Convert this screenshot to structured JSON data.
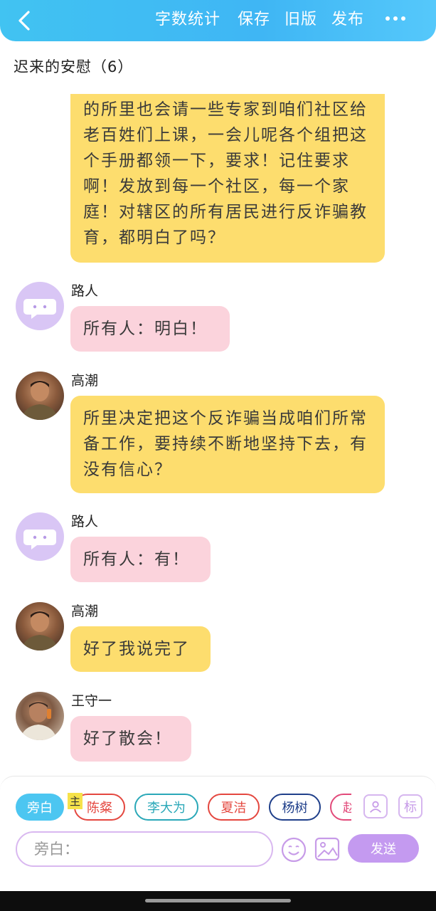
{
  "header": {
    "menu": [
      "字数统计",
      "保存",
      "旧版",
      "发布"
    ]
  },
  "title": "迟来的安慰（6）",
  "messages": [
    {
      "speaker": "",
      "text": "的所里也会请一些专家到咱们社区给老百姓们上课，一会儿呢各个组把这个手册都领一下，要求！记住要求啊！发放到每一个社区，每一个家庭！对辖区的所有居民进行反诈骗教育，都明白了吗？",
      "color": "yellow"
    },
    {
      "speaker": "路人",
      "text": "所有人：明白！",
      "color": "pink"
    },
    {
      "speaker": "高潮",
      "text": "所里决定把这个反诈骗当成咱们所常备工作，要持续不断地坚持下去，有没有信心？",
      "color": "yellow"
    },
    {
      "speaker": "路人",
      "text": "所有人：有！",
      "color": "pink"
    },
    {
      "speaker": "高潮",
      "text": "好了我说完了",
      "color": "yellow"
    },
    {
      "speaker": "王守一",
      "text": "好了散会！",
      "color": "pink"
    }
  ],
  "characters": [
    {
      "label": "旁白",
      "color": "#4cc6f1"
    },
    {
      "label": "陈粲",
      "color": "#e4473f"
    },
    {
      "label": "李大为",
      "color": "#2aa8b8"
    },
    {
      "label": "夏洁",
      "color": "#e4473f"
    },
    {
      "label": "杨树",
      "color": "#1f3f8a"
    },
    {
      "label": "赵",
      "color": "#e24a7a"
    }
  ],
  "main_tag": "主",
  "side_icons": {
    "tag_label": "标"
  },
  "input": {
    "placeholder": "旁白："
  },
  "send_label": "发送",
  "colors": {
    "header": "#41c3f2",
    "yellow_bubble": "#fddd6e",
    "pink_bubble": "#fbd3dc",
    "accent_purple": "#c49af0"
  }
}
